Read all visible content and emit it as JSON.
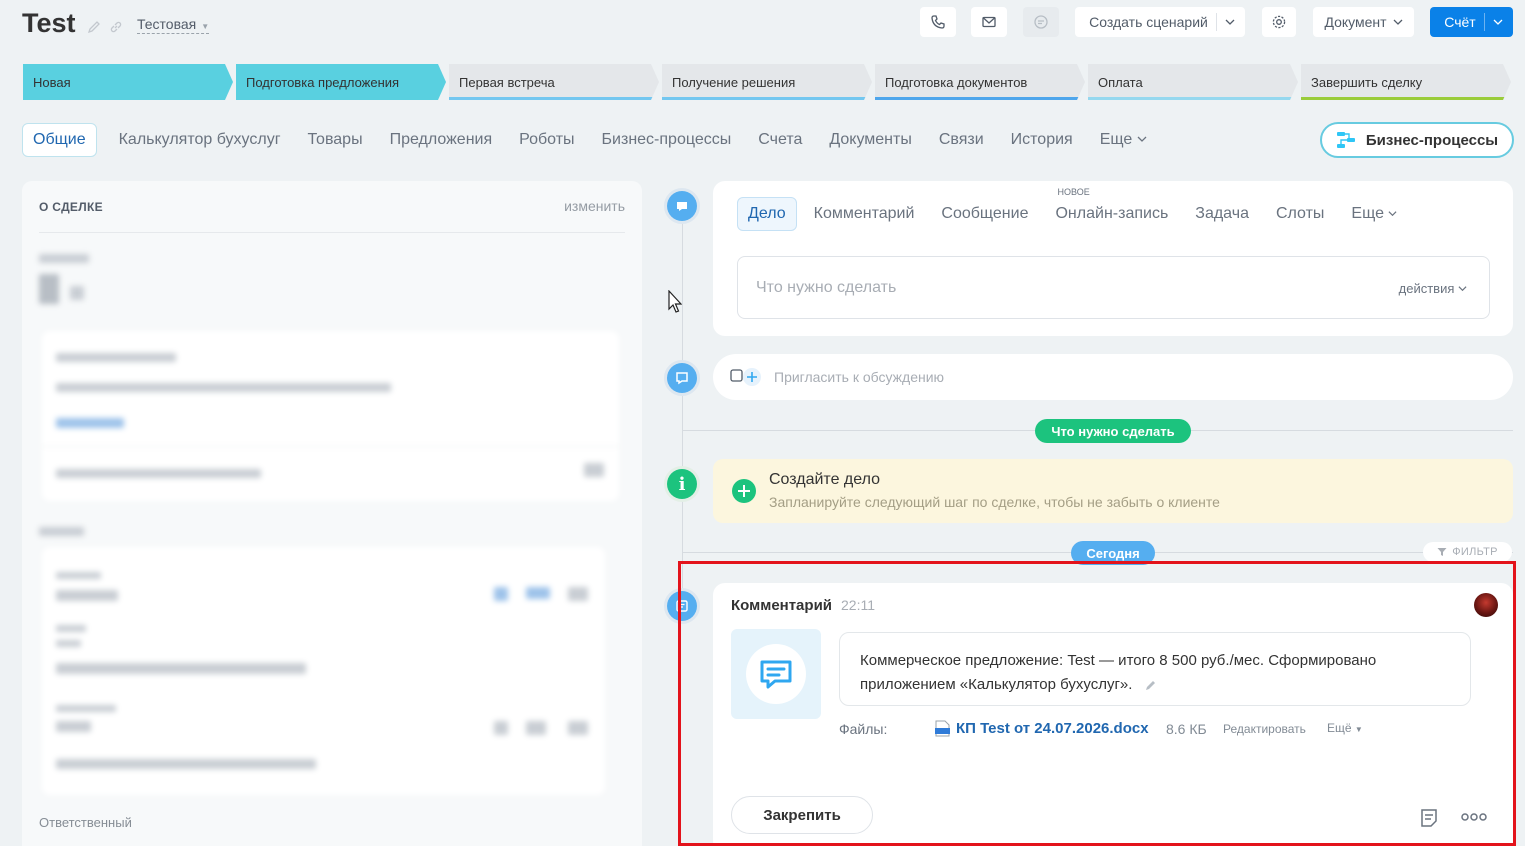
{
  "header": {
    "title": "Test",
    "category": "Тестовая",
    "create_scenario": "Создать сценарий",
    "document": "Документ",
    "invoice": "Счёт"
  },
  "stages": [
    {
      "label": "Новая",
      "color": "#59d0e0",
      "state": "done"
    },
    {
      "label": "Подготовка предложения",
      "color": "#59d0e0",
      "state": "current"
    },
    {
      "label": "Первая встреча",
      "color": "#e4e7ea",
      "bar": "#73c7f0"
    },
    {
      "label": "Получение решения",
      "color": "#e4e7ea",
      "bar": "#73c7f0"
    },
    {
      "label": "Подготовка документов",
      "color": "#e4e7ea",
      "bar": "#4ea6ec"
    },
    {
      "label": "Оплата",
      "color": "#e4e7ea",
      "bar": "#95d8ef"
    },
    {
      "label": "Завершить сделку",
      "color": "#e4e7ea",
      "bar": "#9acc3a"
    }
  ],
  "tabs": [
    "Общие",
    "Калькулятор бухуслуг",
    "Товары",
    "Предложения",
    "Роботы",
    "Бизнес-процессы",
    "Счета",
    "Документы",
    "Связи",
    "История",
    "Еще"
  ],
  "bp_button": "Бизнес-процессы",
  "about": {
    "heading": "О СДЕЛКЕ",
    "edit": "изменить",
    "responsible": "Ответственный"
  },
  "activity": {
    "tabs": [
      "Дело",
      "Комментарий",
      "Сообщение",
      "Онлайн-запись",
      "Задача",
      "Слоты",
      "Еще"
    ],
    "new_badge": "НОВОЕ",
    "todo_placeholder": "Что нужно сделать",
    "actions": "действия",
    "invite_placeholder": "Пригласить к обсуждению"
  },
  "todo_pill": "Что нужно сделать",
  "create_task": {
    "title": "Создайте дело",
    "subtitle": "Запланируйте следующий шаг по сделке, чтобы не забыть о клиенте"
  },
  "today_pill": "Сегодня",
  "filter": "ФИЛЬТР",
  "comment": {
    "label": "Комментарий",
    "time": "22:11",
    "text": "Коммерческое предложение: Test — итого 8 500 руб./мес. Сформировано приложением «Калькулятор бухуслуг».",
    "files_label": "Файлы:",
    "file_name": "КП Test от 24.07.2026.docx",
    "file_size": "8.6 КБ",
    "edit": "Редактировать",
    "more": "Ещё",
    "pin": "Закрепить"
  },
  "colors": {
    "accent_blue": "#0a81e8",
    "stage_cyan": "#59d0e0",
    "green": "#1cc37e",
    "timeline_blue": "#55aef0",
    "highlight_red": "#e3131b"
  }
}
